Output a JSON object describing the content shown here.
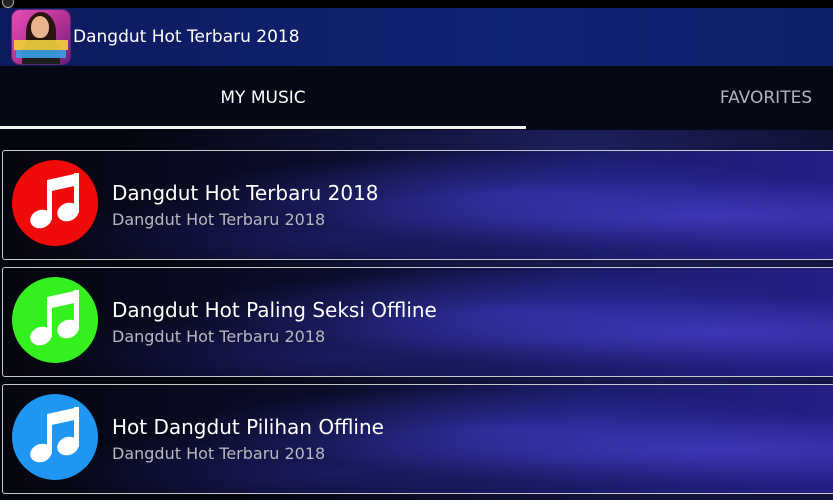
{
  "app": {
    "title": "Dangdut Hot Terbaru 2018"
  },
  "tabs": [
    {
      "label": "MY MUSIC",
      "selected": true
    },
    {
      "label": "FAVORITES",
      "selected": false
    }
  ],
  "songs": [
    {
      "title": "Dangdut Hot Terbaru 2018",
      "artist": "Dangdut Hot Terbaru 2018",
      "icon": "music-note-icon",
      "color": "#f00a0a"
    },
    {
      "title": "Dangdut Hot Paling Seksi Offline",
      "artist": "Dangdut Hot Terbaru 2018",
      "icon": "music-note-icon",
      "color": "#35f01f"
    },
    {
      "title": "Hot Dangdut Pilihan Offline",
      "artist": "Dangdut Hot Terbaru 2018",
      "icon": "music-note-icon",
      "color": "#1e96f2"
    }
  ],
  "colors": {
    "app_bar": "#102272",
    "tab_indicator": "#f2f2f2",
    "background": "#04060f"
  }
}
